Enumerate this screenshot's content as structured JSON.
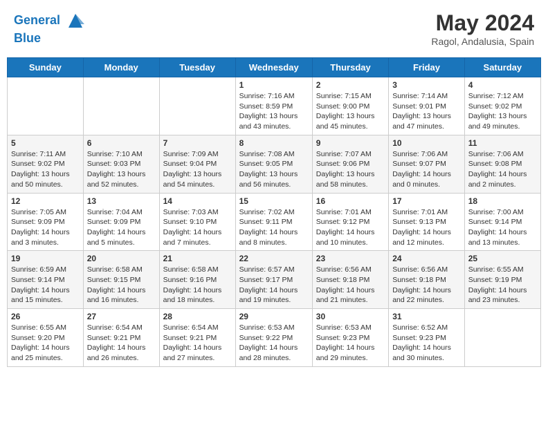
{
  "header": {
    "logo_line1": "General",
    "logo_line2": "Blue",
    "month": "May 2024",
    "location": "Ragol, Andalusia, Spain"
  },
  "weekdays": [
    "Sunday",
    "Monday",
    "Tuesday",
    "Wednesday",
    "Thursday",
    "Friday",
    "Saturday"
  ],
  "weeks": [
    [
      {
        "day": "",
        "info": ""
      },
      {
        "day": "",
        "info": ""
      },
      {
        "day": "",
        "info": ""
      },
      {
        "day": "1",
        "info": "Sunrise: 7:16 AM\nSunset: 8:59 PM\nDaylight: 13 hours\nand 43 minutes."
      },
      {
        "day": "2",
        "info": "Sunrise: 7:15 AM\nSunset: 9:00 PM\nDaylight: 13 hours\nand 45 minutes."
      },
      {
        "day": "3",
        "info": "Sunrise: 7:14 AM\nSunset: 9:01 PM\nDaylight: 13 hours\nand 47 minutes."
      },
      {
        "day": "4",
        "info": "Sunrise: 7:12 AM\nSunset: 9:02 PM\nDaylight: 13 hours\nand 49 minutes."
      }
    ],
    [
      {
        "day": "5",
        "info": "Sunrise: 7:11 AM\nSunset: 9:02 PM\nDaylight: 13 hours\nand 50 minutes."
      },
      {
        "day": "6",
        "info": "Sunrise: 7:10 AM\nSunset: 9:03 PM\nDaylight: 13 hours\nand 52 minutes."
      },
      {
        "day": "7",
        "info": "Sunrise: 7:09 AM\nSunset: 9:04 PM\nDaylight: 13 hours\nand 54 minutes."
      },
      {
        "day": "8",
        "info": "Sunrise: 7:08 AM\nSunset: 9:05 PM\nDaylight: 13 hours\nand 56 minutes."
      },
      {
        "day": "9",
        "info": "Sunrise: 7:07 AM\nSunset: 9:06 PM\nDaylight: 13 hours\nand 58 minutes."
      },
      {
        "day": "10",
        "info": "Sunrise: 7:06 AM\nSunset: 9:07 PM\nDaylight: 14 hours\nand 0 minutes."
      },
      {
        "day": "11",
        "info": "Sunrise: 7:06 AM\nSunset: 9:08 PM\nDaylight: 14 hours\nand 2 minutes."
      }
    ],
    [
      {
        "day": "12",
        "info": "Sunrise: 7:05 AM\nSunset: 9:09 PM\nDaylight: 14 hours\nand 3 minutes."
      },
      {
        "day": "13",
        "info": "Sunrise: 7:04 AM\nSunset: 9:09 PM\nDaylight: 14 hours\nand 5 minutes."
      },
      {
        "day": "14",
        "info": "Sunrise: 7:03 AM\nSunset: 9:10 PM\nDaylight: 14 hours\nand 7 minutes."
      },
      {
        "day": "15",
        "info": "Sunrise: 7:02 AM\nSunset: 9:11 PM\nDaylight: 14 hours\nand 8 minutes."
      },
      {
        "day": "16",
        "info": "Sunrise: 7:01 AM\nSunset: 9:12 PM\nDaylight: 14 hours\nand 10 minutes."
      },
      {
        "day": "17",
        "info": "Sunrise: 7:01 AM\nSunset: 9:13 PM\nDaylight: 14 hours\nand 12 minutes."
      },
      {
        "day": "18",
        "info": "Sunrise: 7:00 AM\nSunset: 9:14 PM\nDaylight: 14 hours\nand 13 minutes."
      }
    ],
    [
      {
        "day": "19",
        "info": "Sunrise: 6:59 AM\nSunset: 9:14 PM\nDaylight: 14 hours\nand 15 minutes."
      },
      {
        "day": "20",
        "info": "Sunrise: 6:58 AM\nSunset: 9:15 PM\nDaylight: 14 hours\nand 16 minutes."
      },
      {
        "day": "21",
        "info": "Sunrise: 6:58 AM\nSunset: 9:16 PM\nDaylight: 14 hours\nand 18 minutes."
      },
      {
        "day": "22",
        "info": "Sunrise: 6:57 AM\nSunset: 9:17 PM\nDaylight: 14 hours\nand 19 minutes."
      },
      {
        "day": "23",
        "info": "Sunrise: 6:56 AM\nSunset: 9:18 PM\nDaylight: 14 hours\nand 21 minutes."
      },
      {
        "day": "24",
        "info": "Sunrise: 6:56 AM\nSunset: 9:18 PM\nDaylight: 14 hours\nand 22 minutes."
      },
      {
        "day": "25",
        "info": "Sunrise: 6:55 AM\nSunset: 9:19 PM\nDaylight: 14 hours\nand 23 minutes."
      }
    ],
    [
      {
        "day": "26",
        "info": "Sunrise: 6:55 AM\nSunset: 9:20 PM\nDaylight: 14 hours\nand 25 minutes."
      },
      {
        "day": "27",
        "info": "Sunrise: 6:54 AM\nSunset: 9:21 PM\nDaylight: 14 hours\nand 26 minutes."
      },
      {
        "day": "28",
        "info": "Sunrise: 6:54 AM\nSunset: 9:21 PM\nDaylight: 14 hours\nand 27 minutes."
      },
      {
        "day": "29",
        "info": "Sunrise: 6:53 AM\nSunset: 9:22 PM\nDaylight: 14 hours\nand 28 minutes."
      },
      {
        "day": "30",
        "info": "Sunrise: 6:53 AM\nSunset: 9:23 PM\nDaylight: 14 hours\nand 29 minutes."
      },
      {
        "day": "31",
        "info": "Sunrise: 6:52 AM\nSunset: 9:23 PM\nDaylight: 14 hours\nand 30 minutes."
      },
      {
        "day": "",
        "info": ""
      }
    ]
  ]
}
